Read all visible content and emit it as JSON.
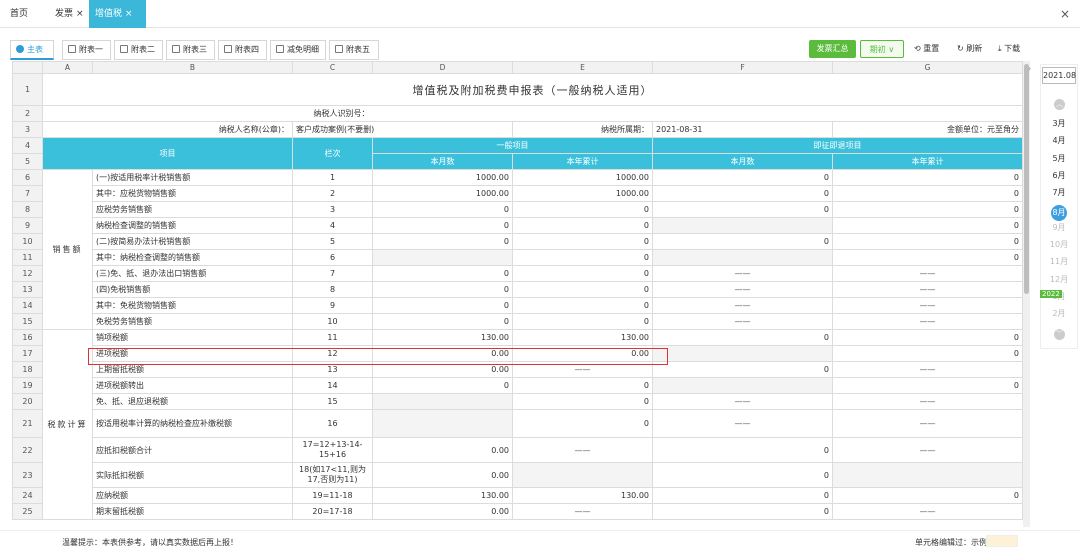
{
  "top_tabs": [
    {
      "label": "首页",
      "closable": false
    },
    {
      "label": "发票",
      "closable": true
    },
    {
      "label": "增值税",
      "closable": true,
      "active": true
    }
  ],
  "close_glyph": "×",
  "sheet_tabs": [
    "主表",
    "附表一",
    "附表二",
    "附表三",
    "附表四",
    "减免明细",
    "附表五"
  ],
  "toolbar": {
    "summary": "发票汇总",
    "period": "期初",
    "reset": "重置",
    "refresh": "刷新",
    "download": "下载"
  },
  "columns": [
    "",
    "A",
    "B",
    "C",
    "D",
    "E",
    "F",
    "G"
  ],
  "sheet": {
    "title": "增值税及附加税费申报表（一般纳税人适用）",
    "taxpayer_id_label": "纳税人识别号：",
    "taxpayer_name_label": "纳税人名称(公章)：",
    "taxpayer_name": "客户成功案例(不要删)",
    "period_label": "纳税所属期：",
    "period": "2021-08-31",
    "unit": "金额单位：元至角分",
    "h_item": "项目",
    "h_col": "栏次",
    "h_general": "一般项目",
    "h_immediate": "即征即退项目",
    "h_month": "本月数",
    "h_ytd": "本年累计",
    "group_sales": "销售额",
    "group_tax": "税款计算"
  },
  "rows": [
    {
      "n": "6",
      "item": "(一)按适用税率计税销售额",
      "col": "1",
      "d": "1000.00",
      "e": "1000.00",
      "f": "0",
      "g": "0"
    },
    {
      "n": "7",
      "item": "其中：应税货物销售额",
      "col": "2",
      "d": "1000.00",
      "e": "1000.00",
      "f": "0",
      "g": "0"
    },
    {
      "n": "8",
      "item": "应税劳务销售额",
      "col": "3",
      "d": "0",
      "e": "0",
      "f": "0",
      "g": "0"
    },
    {
      "n": "9",
      "item": "纳税检查调整的销售额",
      "col": "4",
      "d": "0",
      "e": "0",
      "f": "",
      "g": "0"
    },
    {
      "n": "10",
      "item": "(二)按简易办法计税销售额",
      "col": "5",
      "d": "0",
      "e": "0",
      "f": "0",
      "g": "0"
    },
    {
      "n": "11",
      "item": "其中：纳税检查调整的销售额",
      "col": "6",
      "d": "",
      "e": "0",
      "f": "",
      "g": "0"
    },
    {
      "n": "12",
      "item": "(三)免、抵、退办法出口销售额",
      "col": "7",
      "d": "0",
      "e": "0",
      "f": "——",
      "g": "——"
    },
    {
      "n": "13",
      "item": "(四)免税销售额",
      "col": "8",
      "d": "0",
      "e": "0",
      "f": "——",
      "g": "——"
    },
    {
      "n": "14",
      "item": "其中：免税货物销售额",
      "col": "9",
      "d": "0",
      "e": "0",
      "f": "——",
      "g": "——"
    },
    {
      "n": "15",
      "item": "免税劳务销售额",
      "col": "10",
      "d": "0",
      "e": "0",
      "f": "——",
      "g": "——"
    },
    {
      "n": "16",
      "item": "销项税额",
      "col": "11",
      "d": "130.00",
      "e": "130.00",
      "f": "0",
      "g": "0"
    },
    {
      "n": "17",
      "item": "进项税额",
      "col": "12",
      "d": "0.00",
      "e": "0.00",
      "f": "",
      "g": "0"
    },
    {
      "n": "18",
      "item": "上期留抵税额",
      "col": "13",
      "d": "0.00",
      "e": "——",
      "f": "0",
      "g": "——"
    },
    {
      "n": "19",
      "item": "进项税额转出",
      "col": "14",
      "d": "0",
      "e": "0",
      "f": "",
      "g": "0"
    },
    {
      "n": "20",
      "item": "免、抵、退应退税额",
      "col": "15",
      "d": "",
      "e": "0",
      "f": "——",
      "g": "——"
    },
    {
      "n": "21",
      "item": "按适用税率计算的纳税检查应补缴税额",
      "col": "16",
      "d": "",
      "e": "0",
      "f": "——",
      "g": "——"
    },
    {
      "n": "22",
      "item": "应抵扣税额合计",
      "col": "17=12+13-14-15+16",
      "d": "0.00",
      "e": "——",
      "f": "0",
      "g": "——"
    },
    {
      "n": "23",
      "item": "实际抵扣税额",
      "col": "18(如17<11,则为17,否则为11)",
      "d": "0.00",
      "e": "",
      "f": "0",
      "g": ""
    },
    {
      "n": "24",
      "item": "应纳税额",
      "col": "19=11-18",
      "d": "130.00",
      "e": "130.00",
      "f": "0",
      "g": "0"
    },
    {
      "n": "25",
      "item": "期末留抵税额",
      "col": "20=17-18",
      "d": "0.00",
      "e": "——",
      "f": "0",
      "g": "——"
    }
  ],
  "month_panel": {
    "year": "2021.08",
    "months": [
      "3月",
      "4月",
      "5月",
      "6月",
      "7月",
      "8月",
      "9月",
      "10月",
      "11月",
      "12月",
      "1月",
      "2月"
    ],
    "next_year": "2022",
    "up": "︿",
    "down": "﹀"
  },
  "footer": {
    "tip": "温馨提示：本表供参考，请以真实数据后再上报！",
    "legend": "单元格编辑过：示例"
  }
}
